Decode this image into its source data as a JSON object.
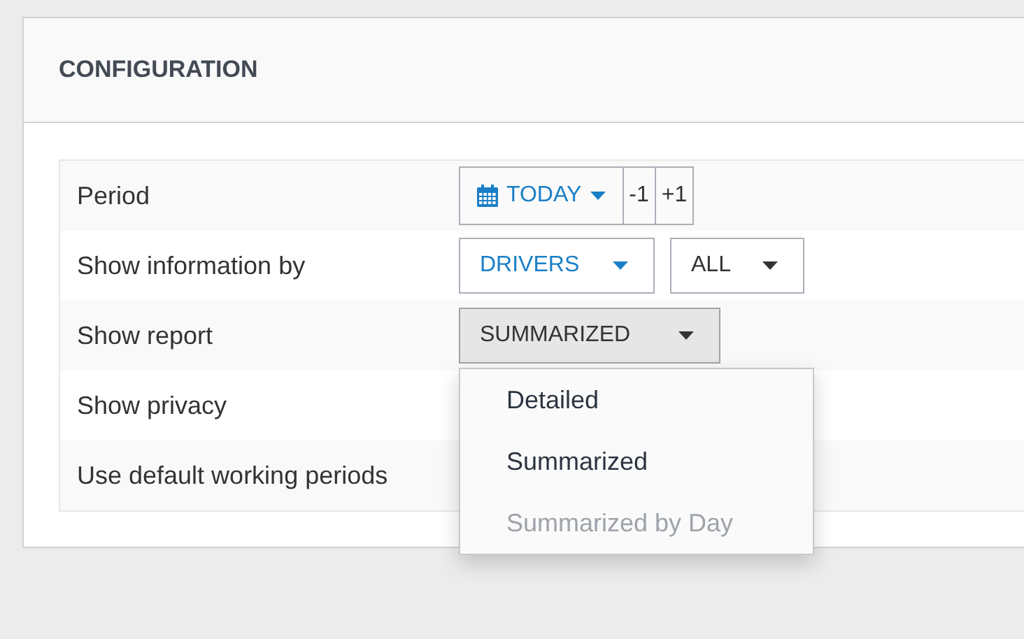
{
  "panel": {
    "title": "CONFIGURATION"
  },
  "rows": [
    {
      "label": "Period",
      "kind": "period",
      "value": "TODAY",
      "steps": [
        "-1",
        "+1"
      ]
    },
    {
      "label": "Show information by",
      "kind": "selects",
      "selects": [
        {
          "value": "DRIVERS",
          "accent": true
        },
        {
          "value": "ALL",
          "accent": false
        }
      ]
    },
    {
      "label": "Show report",
      "kind": "dropdown",
      "value": "SUMMARIZED",
      "open": true,
      "options": [
        {
          "label": "Detailed",
          "disabled": false
        },
        {
          "label": "Summarized",
          "disabled": false
        },
        {
          "label": "Summarized by Day",
          "disabled": true
        }
      ]
    },
    {
      "label": "Show privacy",
      "kind": "hidden"
    },
    {
      "label": "Use default working periods",
      "kind": "hidden"
    }
  ]
}
